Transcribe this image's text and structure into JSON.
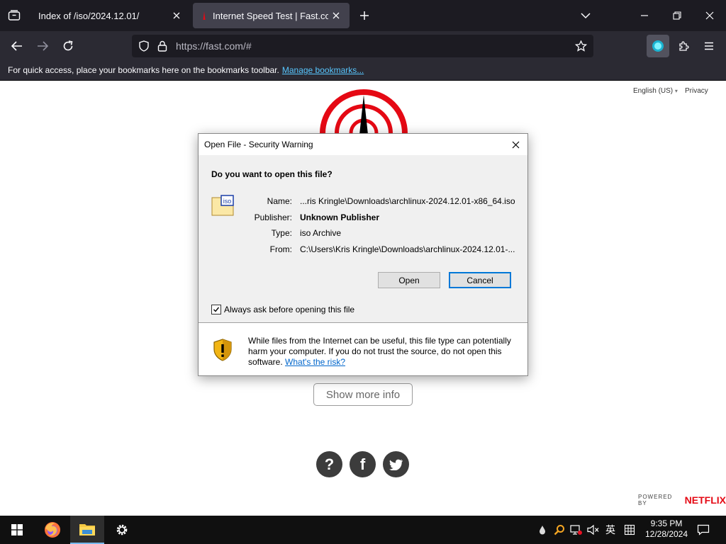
{
  "browser": {
    "tabs": [
      {
        "label": "Index of /iso/2024.12.01/",
        "active": false
      },
      {
        "label": "Internet Speed Test | Fast.com",
        "active": true
      }
    ],
    "url": "https://fast.com/#",
    "bookmarks_message": "For quick access, place your bookmarks here on the bookmarks toolbar.",
    "bookmarks_link": "Manage bookmarks...",
    "colors": {
      "chrome_dark": "#1c1b22",
      "chrome": "#2b2a33",
      "active_tab": "#42414d",
      "link": "#58c7ff"
    }
  },
  "page": {
    "language": "English (US)",
    "privacy": "Privacy",
    "show_more": "Show more info",
    "powered_by": "POWERED BY",
    "brand": "NETFLIX",
    "social": [
      "help-icon",
      "facebook-icon",
      "twitter-icon"
    ],
    "colors": {
      "gauge_red": "#e50914",
      "social_bg": "#3c3c3c"
    }
  },
  "dialog": {
    "title": "Open File - Security Warning",
    "question": "Do you want to open this file?",
    "file_icon_label": "iso",
    "fields": [
      {
        "label": "Name:",
        "value": "...ris Kringle\\Downloads\\archlinux-2024.12.01-x86_64.iso"
      },
      {
        "label": "Publisher:",
        "value": "Unknown Publisher"
      },
      {
        "label": "Type:",
        "value": "iso Archive"
      },
      {
        "label": "From:",
        "value": "C:\\Users\\Kris Kringle\\Downloads\\archlinux-2024.12.01-..."
      }
    ],
    "open_button": "Open",
    "cancel_button": "Cancel",
    "checkbox_label": "Always ask before opening this file",
    "checkbox_checked": true,
    "warning_text": "While files from the Internet can be useful, this file type can potentially harm your computer. If you do not trust the source, do not open this software.",
    "risk_link": "What's the risk?"
  },
  "taskbar": {
    "apps": [
      "firefox-icon",
      "file-explorer-icon",
      "settings-icon"
    ],
    "tray": [
      "teardrop-icon",
      "search-tool-icon",
      "network-icon",
      "volume-muted-icon"
    ],
    "ime": "英",
    "time": "9:35 PM",
    "date": "12/28/2024"
  }
}
